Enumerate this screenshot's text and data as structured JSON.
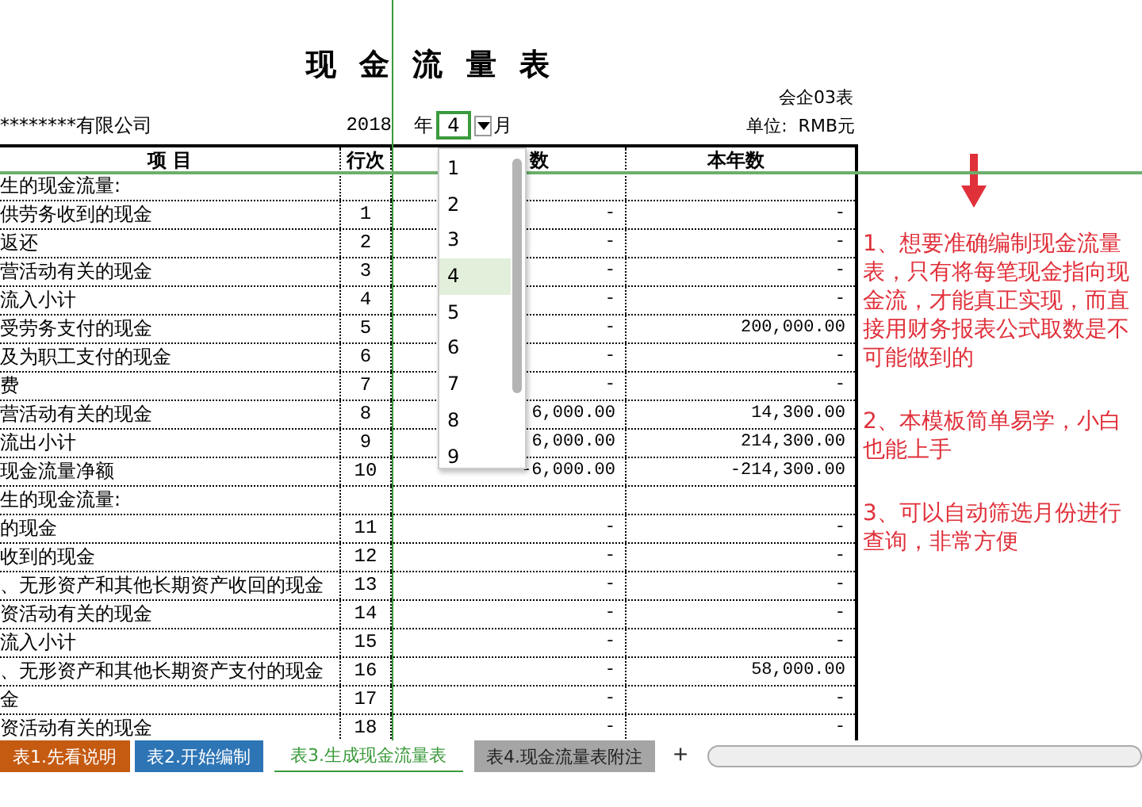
{
  "title": "现 金 流 量 表",
  "form_no": "会企03表",
  "company": "********有限公司",
  "year": "2018",
  "year_label": "年",
  "month": "4",
  "month_label": "月",
  "unit": "单位:  RMB元",
  "columns": [
    "项  目",
    "行次",
    "数",
    "本年数"
  ],
  "rows": [
    {
      "kind": "section",
      "item": "生的现金流量:"
    },
    {
      "kind": "data",
      "item": "供劳务收到的现金",
      "line": "1",
      "month": "-",
      "year": "-"
    },
    {
      "kind": "data",
      "item": "返还",
      "line": "2",
      "month": "-",
      "year": "-"
    },
    {
      "kind": "data",
      "item": "营活动有关的现金",
      "line": "3",
      "month": "-",
      "year": "-"
    },
    {
      "kind": "data",
      "item": "流入小计",
      "line": "4",
      "month": "-",
      "year": "-"
    },
    {
      "kind": "data",
      "item": "受劳务支付的现金",
      "line": "5",
      "month": "-",
      "year": "200,000.00"
    },
    {
      "kind": "data",
      "item": "及为职工支付的现金",
      "line": "6",
      "month": "-",
      "year": "-"
    },
    {
      "kind": "data",
      "item": "费",
      "line": "7",
      "month": "-",
      "year": "-"
    },
    {
      "kind": "data",
      "item": "营活动有关的现金",
      "line": "8",
      "month": "6,000.00",
      "year": "14,300.00"
    },
    {
      "kind": "data",
      "item": "流出小计",
      "line": "9",
      "month": "6,000.00",
      "year": "214,300.00"
    },
    {
      "kind": "data",
      "item": "现金流量净额",
      "line": "10",
      "month": "-6,000.00",
      "year": "-214,300.00"
    },
    {
      "kind": "section",
      "item": "生的现金流量:"
    },
    {
      "kind": "data",
      "item": "的现金",
      "line": "11",
      "month": "-",
      "year": "-"
    },
    {
      "kind": "data",
      "item": "收到的现金",
      "line": "12",
      "month": "-",
      "year": "-"
    },
    {
      "kind": "data",
      "item": "、无形资产和其他长期资产收回的现金",
      "line": "13",
      "month": "-",
      "year": "-"
    },
    {
      "kind": "data",
      "item": "资活动有关的现金",
      "line": "14",
      "month": "-",
      "year": "-"
    },
    {
      "kind": "data",
      "item": "流入小计",
      "line": "15",
      "month": "-",
      "year": "-"
    },
    {
      "kind": "data",
      "item": "、无形资产和其他长期资产支付的现金",
      "line": "16",
      "month": "-",
      "year": "58,000.00"
    },
    {
      "kind": "data",
      "item": "金",
      "line": "17",
      "month": "-",
      "year": "-"
    },
    {
      "kind": "data",
      "item": "资活动有关的现金",
      "line": "18",
      "month": "-",
      "year": "-"
    }
  ],
  "dropdown": {
    "options": [
      {
        "label": "1",
        "selected": false
      },
      {
        "label": "2",
        "selected": false
      },
      {
        "label": "3",
        "selected": false
      },
      {
        "label": "4",
        "selected": true
      },
      {
        "label": "5",
        "selected": false
      },
      {
        "label": "6",
        "selected": false
      },
      {
        "label": "7",
        "selected": false
      },
      {
        "label": "8",
        "selected": false
      },
      {
        "label": "9",
        "selected": false
      }
    ]
  },
  "notes": [
    "1、想要准确编制现金流量表，只有将每笔现金指向现金流，才能真正实现，而直接用财务报表公式取数是不可能做到的",
    "2、本模板简单易学，小白也能上手",
    "3、可以自动筛选月份进行查询，非常方便"
  ],
  "sheet_tabs": [
    {
      "label": "表1.先看说明",
      "selected": false,
      "color": "#c55a11"
    },
    {
      "label": "表2.开始编制",
      "selected": false,
      "color": "#2e75b6"
    },
    {
      "label": "表3.生成现金流量表",
      "selected": true,
      "color": "#ffffff"
    },
    {
      "label": "表4.现金流量表附注",
      "selected": false,
      "color": "#a5a5a5"
    }
  ],
  "add_tab": "+"
}
